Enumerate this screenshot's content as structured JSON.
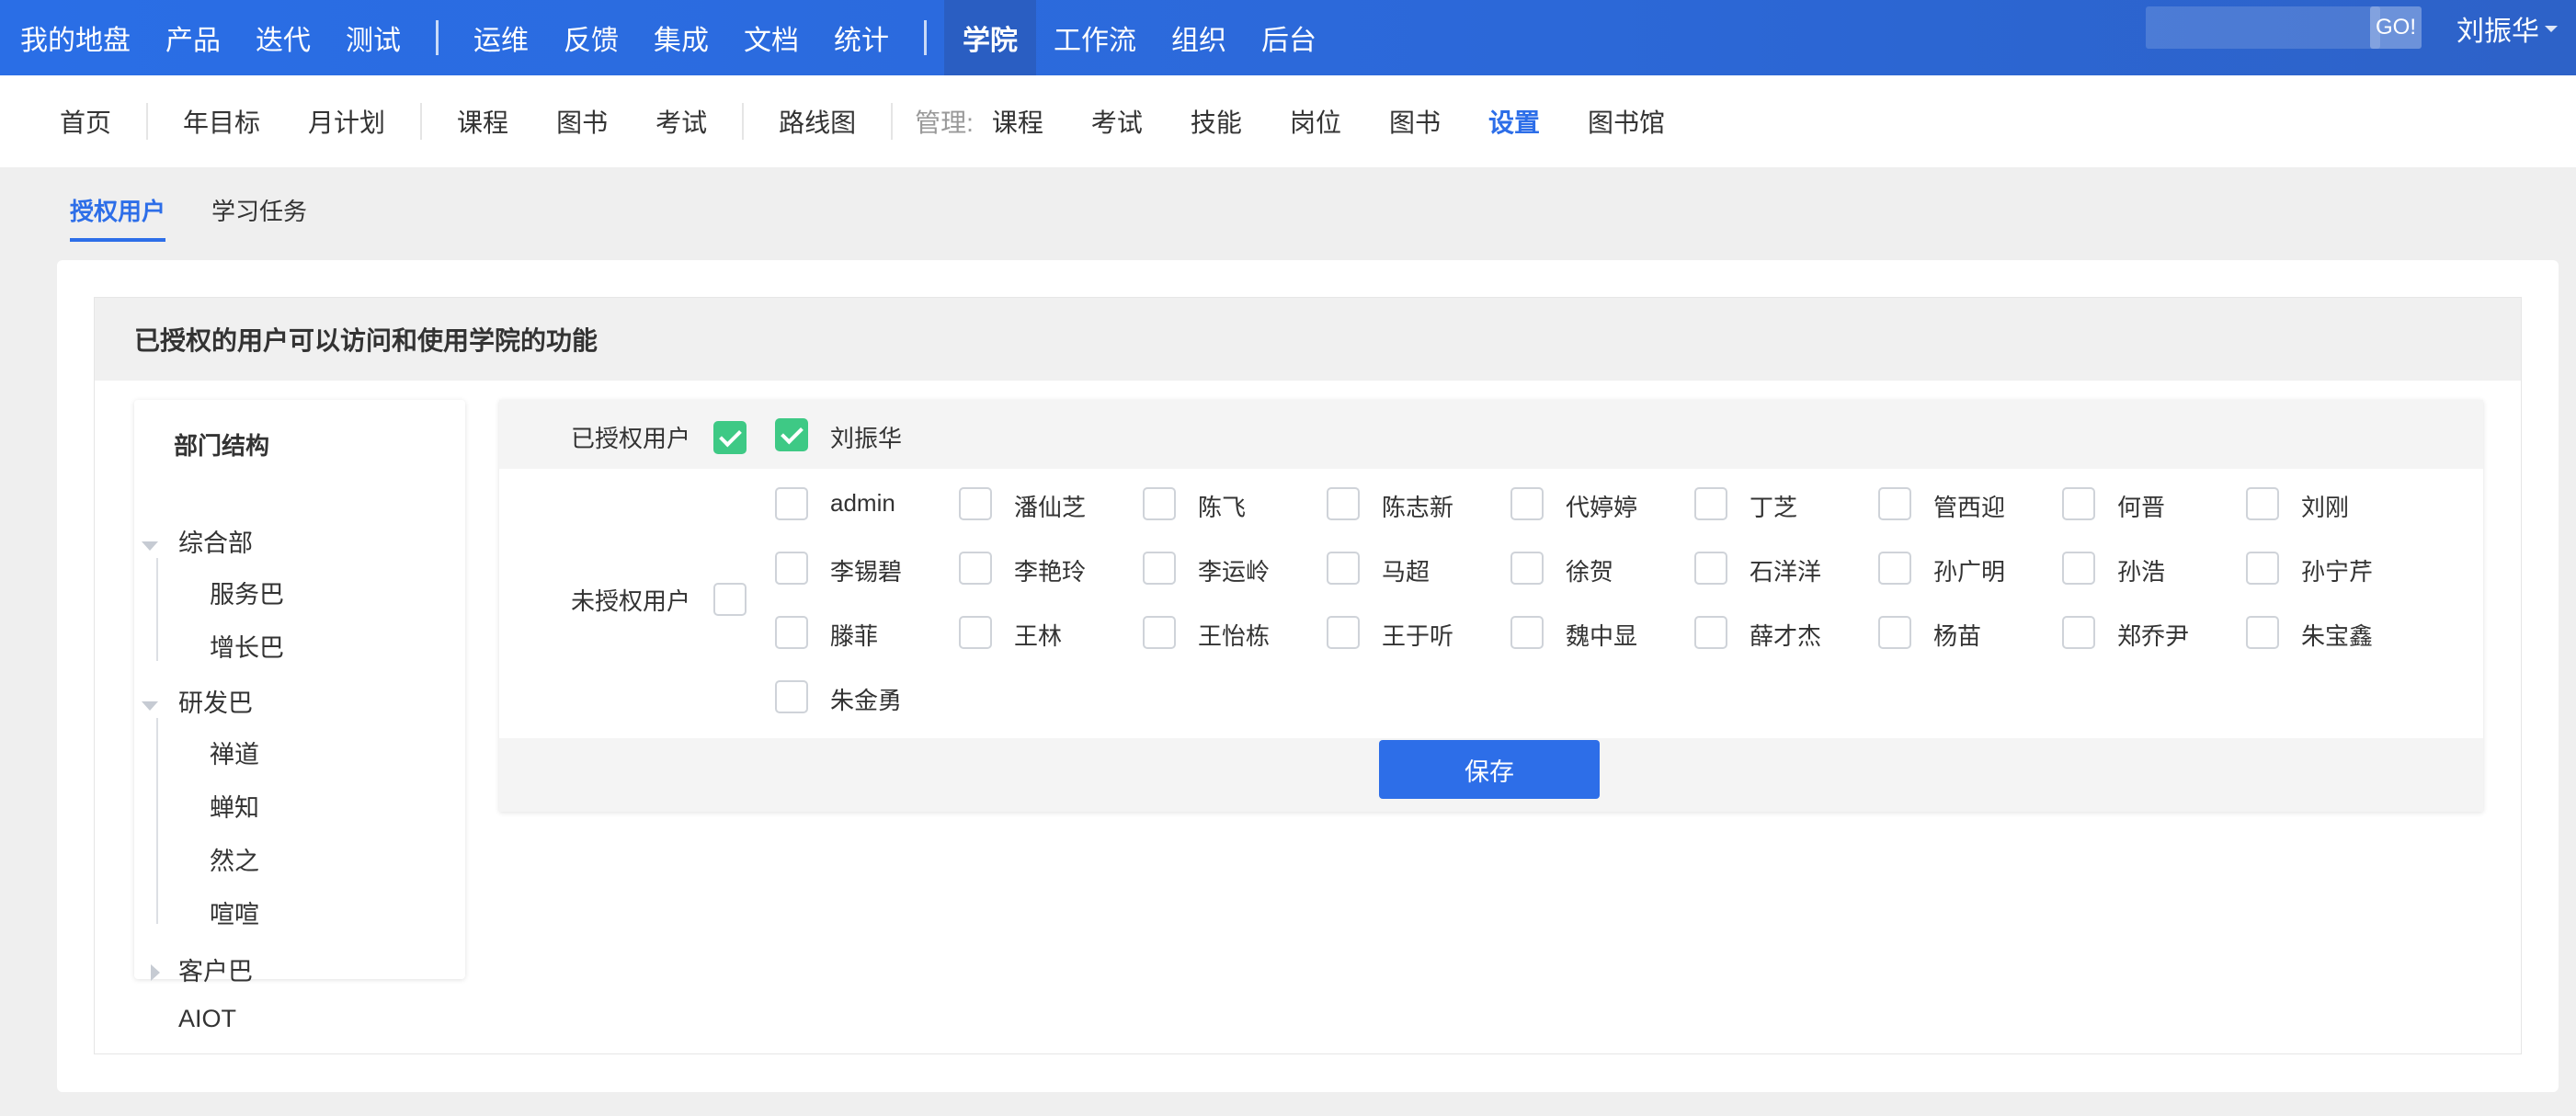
{
  "topnav": {
    "group1": [
      "我的地盘",
      "产品",
      "迭代",
      "测试"
    ],
    "group2": [
      "运维",
      "反馈",
      "集成",
      "文档",
      "统计"
    ],
    "group3": [
      "学院",
      "工作流",
      "组织",
      "后台"
    ],
    "active": "学院",
    "search_placeholder": "",
    "go_label": "GO!",
    "user_name": "刘振华"
  },
  "subnav": {
    "group1": [
      "首页"
    ],
    "group2": [
      "年目标",
      "月计划"
    ],
    "group3": [
      "课程",
      "图书",
      "考试"
    ],
    "group4": [
      "路线图"
    ],
    "manage_label": "管理:",
    "manage_items": [
      "课程",
      "考试",
      "技能",
      "岗位",
      "图书",
      "设置",
      "图书馆"
    ],
    "active": "设置"
  },
  "tabs": [
    {
      "label": "授权用户",
      "active": true
    },
    {
      "label": "学习任务",
      "active": false
    }
  ],
  "panel": {
    "title": "已授权的用户可以访问和使用学院的功能"
  },
  "tree": {
    "title": "部门结构",
    "nodes": [
      {
        "label": "综合部",
        "level": 0,
        "expanded": true
      },
      {
        "label": "服务巴",
        "level": 1
      },
      {
        "label": "增长巴",
        "level": 1
      },
      {
        "label": "研发巴",
        "level": 0,
        "expanded": true
      },
      {
        "label": "禅道",
        "level": 1
      },
      {
        "label": "蝉知",
        "level": 1
      },
      {
        "label": "然之",
        "level": 1
      },
      {
        "label": "喧喧",
        "level": 1
      },
      {
        "label": "客户巴",
        "level": 0,
        "expanded": false
      },
      {
        "label": "AIOT",
        "level": 0
      }
    ]
  },
  "form": {
    "authorized_label": "已授权用户",
    "authorized_all_checked": true,
    "authorized_users": [
      {
        "name": "刘振华",
        "checked": true
      }
    ],
    "unauthorized_label": "未授权用户",
    "unauthorized_all_checked": false,
    "unauthorized_users": [
      "admin",
      "潘仙芝",
      "陈飞",
      "陈志新",
      "代婷婷",
      "丁芝",
      "管西迎",
      "何晋",
      "刘刚",
      "李锡碧",
      "李艳玲",
      "李运岭",
      "马超",
      "徐贺",
      "石洋洋",
      "孙广明",
      "孙浩",
      "孙宁芹",
      "滕菲",
      "王林",
      "王怡栋",
      "王于听",
      "魏中显",
      "薛才杰",
      "杨苗",
      "郑乔尹",
      "朱宝鑫",
      "朱金勇"
    ],
    "save_label": "保存"
  },
  "colors": {
    "primary": "#2d6ee8",
    "check_green": "#3ec985",
    "topbar": "#2a6ee6"
  }
}
